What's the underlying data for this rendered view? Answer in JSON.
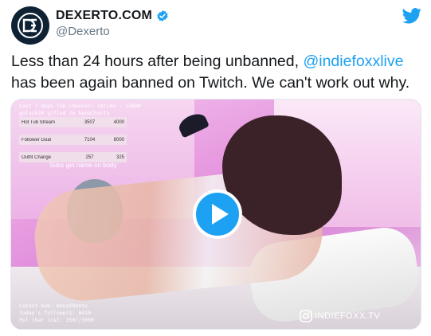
{
  "author": {
    "display_name": "DEXERTO.COM",
    "handle": "@Dexerto",
    "verified": true,
    "avatar_icon": "dexerto-logo-icon"
  },
  "platform_icon": "twitter-bird-icon",
  "colors": {
    "link": "#1da1f2",
    "text": "#14171a",
    "secondary": "#657786"
  },
  "tweet": {
    "text_before": "Less than 24 hours after being unbanned, ",
    "mention": "@indiefoxxlive",
    "text_after": " has been again banned on Twitch. We can't work out why."
  },
  "media": {
    "type": "video",
    "play_icon": "play-icon",
    "overlay": {
      "top_line_1": "Last 7 days Top Cheerer: r8rikv - 11800",
      "top_line_2": "golack20 gifted to benathontv",
      "goals": [
        {
          "label": "Hot Tub Stream",
          "progress": "3507",
          "target": "4000"
        },
        {
          "label": "Follower Goal",
          "progress": "7104",
          "target": "8000"
        },
        {
          "label": "Outfit Change",
          "progress": "257",
          "target": "325"
        }
      ],
      "subs_note": "Subs get name on body",
      "bottom_line_1": "Latest Sub: benathontv",
      "bottom_line_2": "Today's followers: 8410",
      "bottom_line_3": "Ppl that lost: 3507/3000"
    },
    "watermark": "INDIEFOXX.TV",
    "watermark_icon": "instagram-icon"
  }
}
